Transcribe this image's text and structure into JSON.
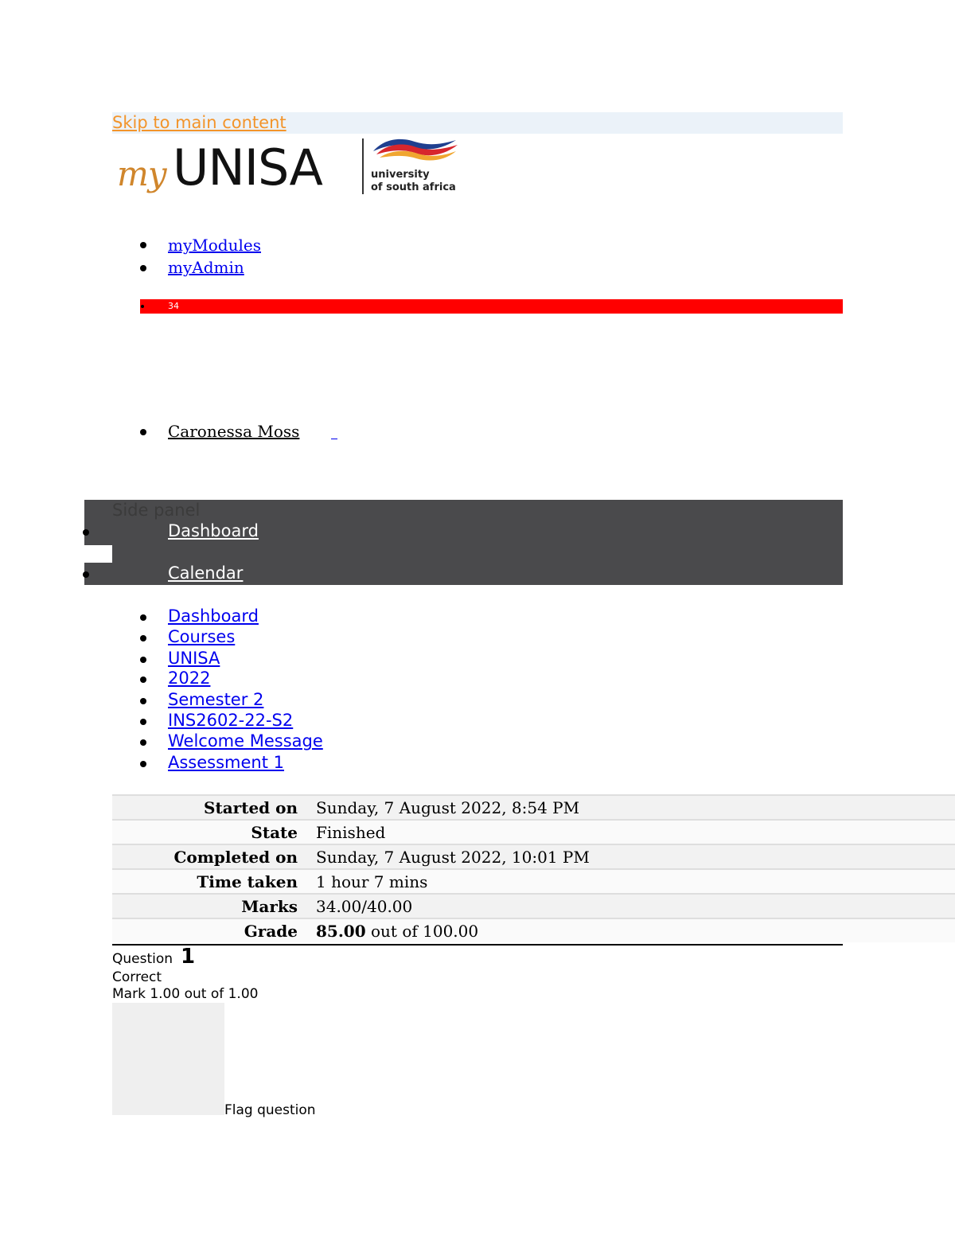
{
  "skip_link": "Skip to main content",
  "logo": {
    "my": "my",
    "brand": "UNISA",
    "tagline_line1": "university",
    "tagline_line2": "of south africa"
  },
  "top_nav": {
    "items": [
      "myModules ",
      "myAdmin"
    ]
  },
  "notifications": {
    "count": "34"
  },
  "user": {
    "name": "Caronessa Moss"
  },
  "side_panel": {
    "title": "Side panel",
    "items": [
      "Dashboard",
      "Calendar"
    ]
  },
  "breadcrumb": [
    "Dashboard",
    "Courses",
    "UNISA",
    "2022",
    "Semester 2",
    "INS2602-22-S2",
    "Welcome Message",
    "Assessment 1"
  ],
  "summary": {
    "rows": [
      {
        "label": "Started on",
        "value": "Sunday, 7 August 2022, 8:54 PM"
      },
      {
        "label": "State",
        "value": "Finished"
      },
      {
        "label": "Completed on",
        "value": "Sunday, 7 August 2022, 10:01 PM"
      },
      {
        "label": "Time taken",
        "value": "1 hour 7 mins"
      },
      {
        "label": "Marks",
        "value": "34.00/40.00"
      },
      {
        "label": "Grade",
        "value_bold": "85.00",
        "value_rest": " out of 100.00"
      }
    ]
  },
  "question": {
    "label": "Question",
    "number": "1",
    "state": "Correct",
    "mark": "Mark 1.00 out of 1.00",
    "flag_label": "Flag question"
  },
  "colors": {
    "skip_link": "#f3942a",
    "link": "#0000ee",
    "badge_bar": "#ff0000",
    "side_panel": "#4a4a4c"
  }
}
